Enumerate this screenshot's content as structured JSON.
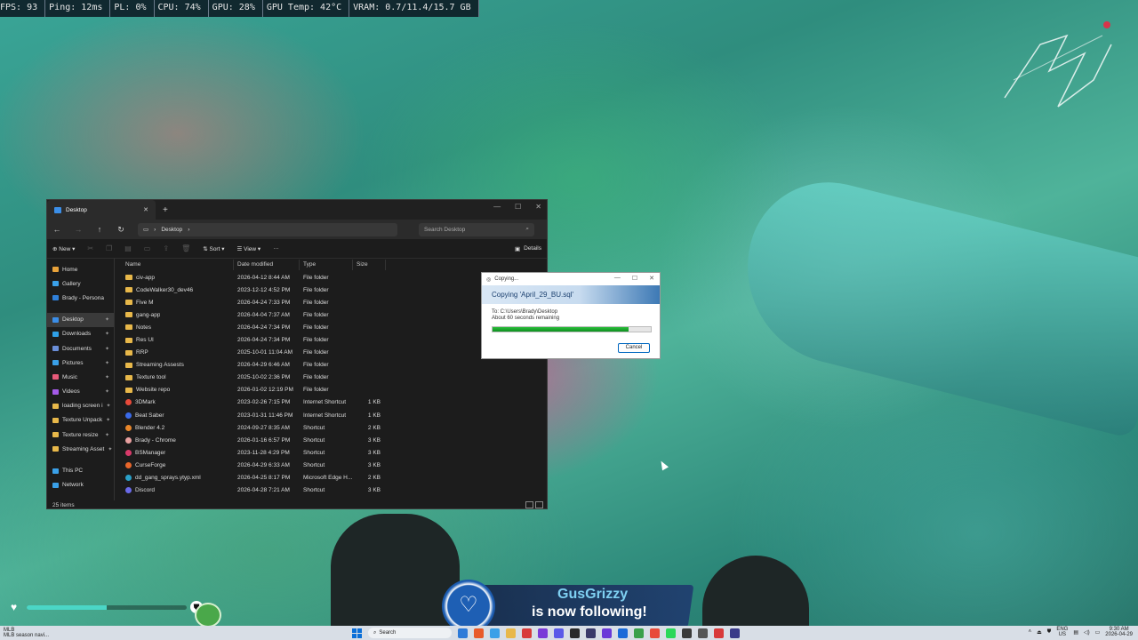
{
  "overlay_stats": [
    "FPS: 93",
    "Ping: 12ms",
    "PL: 0%",
    "CPU: 74%",
    "GPU: 28%",
    "GPU Temp: 42°C",
    "VRAM: 0.7/11.4/15.7 GB"
  ],
  "explorer": {
    "tab_title": "Desktop",
    "address": "Desktop",
    "search_placeholder": "Search Desktop",
    "toolbar": {
      "new": "New",
      "sort": "Sort",
      "view": "View",
      "more": "···",
      "details": "Details"
    },
    "sidebar": {
      "top": [
        {
          "label": "Home",
          "color": "#e8a23a"
        },
        {
          "label": "Gallery",
          "color": "#3aa0e8"
        },
        {
          "label": "Brady - Persona",
          "color": "#2f7fd8"
        }
      ],
      "pinned": [
        {
          "label": "Desktop",
          "color": "#3b8ee8",
          "selected": true
        },
        {
          "label": "Downloads",
          "color": "#2fa0e8"
        },
        {
          "label": "Documents",
          "color": "#6a8ed8"
        },
        {
          "label": "Pictures",
          "color": "#3aa0e8"
        },
        {
          "label": "Music",
          "color": "#e85a7a"
        },
        {
          "label": "Videos",
          "color": "#a45ae8"
        },
        {
          "label": "loading screen i",
          "color": "#e8b84a"
        },
        {
          "label": "Texture Unpack",
          "color": "#e8b84a"
        },
        {
          "label": "Texture resize",
          "color": "#e8b84a"
        },
        {
          "label": "Streaming Asset",
          "color": "#e8b84a"
        }
      ],
      "bottom": [
        {
          "label": "This PC",
          "color": "#3aa0e8"
        },
        {
          "label": "Network",
          "color": "#3aa0e8"
        }
      ]
    },
    "columns": [
      "Name",
      "Date modified",
      "Type",
      "Size"
    ],
    "files": [
      {
        "name": "civ-app",
        "date": "2026-04-12 8:44 AM",
        "type": "File folder",
        "size": "",
        "kind": "folder"
      },
      {
        "name": "CodeWalker30_dev46",
        "date": "2023-12-12 4:52 PM",
        "type": "File folder",
        "size": "",
        "kind": "folder"
      },
      {
        "name": "Five M",
        "date": "2026-04-24 7:33 PM",
        "type": "File folder",
        "size": "",
        "kind": "folder"
      },
      {
        "name": "gang-app",
        "date": "2026-04-04 7:37 AM",
        "type": "File folder",
        "size": "",
        "kind": "folder"
      },
      {
        "name": "Notes",
        "date": "2026-04-24 7:34 PM",
        "type": "File folder",
        "size": "",
        "kind": "folder"
      },
      {
        "name": "Res UI",
        "date": "2026-04-24 7:34 PM",
        "type": "File folder",
        "size": "",
        "kind": "folder"
      },
      {
        "name": "RRP",
        "date": "2025-10-01 11:04 AM",
        "type": "File folder",
        "size": "",
        "kind": "folder"
      },
      {
        "name": "Streaming Assests",
        "date": "2026-04-29 6:46 AM",
        "type": "File folder",
        "size": "",
        "kind": "folder"
      },
      {
        "name": "Texture tool",
        "date": "2025-10-02 2:36 PM",
        "type": "File folder",
        "size": "",
        "kind": "folder"
      },
      {
        "name": "Website repo",
        "date": "2026-01-02 12:19 PM",
        "type": "File folder",
        "size": "",
        "kind": "folder"
      },
      {
        "name": "3DMark",
        "date": "2023-02-26 7:15 PM",
        "type": "Internet Shortcut",
        "size": "1 KB",
        "kind": "shortcut",
        "color": "#e84a3a"
      },
      {
        "name": "Beat Saber",
        "date": "2023-01-31 11:46 PM",
        "type": "Internet Shortcut",
        "size": "1 KB",
        "kind": "shortcut",
        "color": "#3a6ae8"
      },
      {
        "name": "Blender 4.2",
        "date": "2024-09-27 8:35 AM",
        "type": "Shortcut",
        "size": "2 KB",
        "kind": "shortcut",
        "color": "#e8862a"
      },
      {
        "name": "Brady - Chrome",
        "date": "2026-01-16 6:57 PM",
        "type": "Shortcut",
        "size": "3 KB",
        "kind": "shortcut",
        "color": "#e8a0a0"
      },
      {
        "name": "BSManager",
        "date": "2023-11-28 4:29 PM",
        "type": "Shortcut",
        "size": "3 KB",
        "kind": "shortcut",
        "color": "#d83a6a"
      },
      {
        "name": "CurseForge",
        "date": "2026-04-29 6:33 AM",
        "type": "Shortcut",
        "size": "3 KB",
        "kind": "shortcut",
        "color": "#e8662a"
      },
      {
        "name": "dd_gang_sprays.ytyp.xml",
        "date": "2026-04-25 8:17 PM",
        "type": "Microsoft Edge H...",
        "size": "2 KB",
        "kind": "shortcut",
        "color": "#2aa0c8"
      },
      {
        "name": "Discord",
        "date": "2026-04-28 7:21 AM",
        "type": "Shortcut",
        "size": "3 KB",
        "kind": "shortcut",
        "color": "#6a6ae8"
      }
    ],
    "status": "25 items"
  },
  "copy_dialog": {
    "title": "Copying...",
    "heading": "Copying 'April_29_BU.sql'",
    "to_line": "To: C:\\Users\\Brady\\Desktop",
    "time_line": "About 60 seconds remaining",
    "progress": 0.86,
    "cancel": "Cancel"
  },
  "follow_alert": {
    "name": "GusGrizzy",
    "text": "is now following!"
  },
  "hud": {
    "health": 0.5,
    "armor": 0.0
  },
  "taskbar": {
    "weather_title": "MLB",
    "weather_sub": "MLB season navi...",
    "search": "Search",
    "apps": [
      "#2d7ad8",
      "#e85a2a",
      "#3aa0e8",
      "#e8b84a",
      "#d83a3a",
      "#7a3ad8",
      "#5a5ae8",
      "#2a2a2a",
      "#3a3a6a",
      "#6a3ad8",
      "#1a6ad8",
      "#3aa04a",
      "#e84a3a",
      "#2ad85a",
      "#3a3a3a",
      "#555",
      "#d83a3a",
      "#3a3a8a"
    ],
    "lang_top": "ENG",
    "lang_bottom": "US",
    "time": "9:30 AM",
    "date": "2026-04-29"
  }
}
